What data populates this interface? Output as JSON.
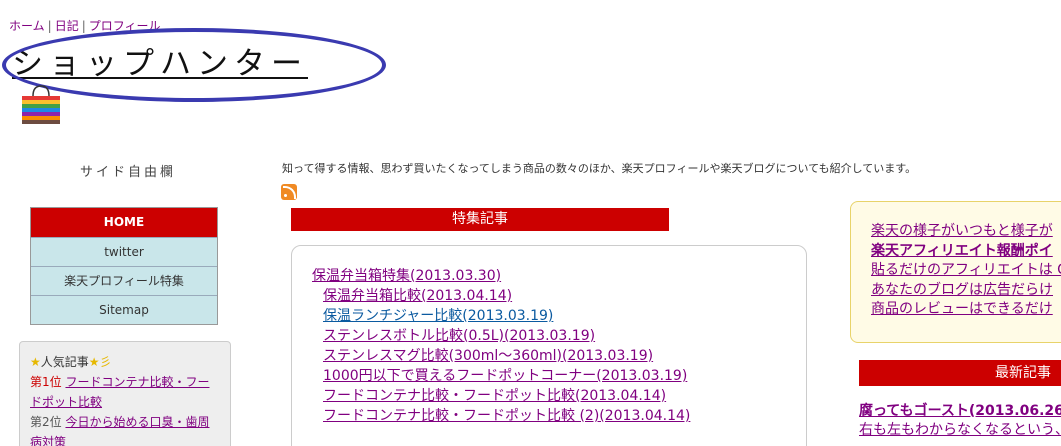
{
  "nav": {
    "home": "ホーム",
    "diary": "日記",
    "profile": "プロフィール",
    "sep": "|"
  },
  "site": {
    "title": "ショップハンター"
  },
  "sidebar": {
    "title": "サイド自由欄",
    "menu": [
      "HOME",
      "twitter",
      "楽天プロフィール特集",
      "Sitemap"
    ],
    "popular": {
      "heading": "人気記事",
      "items": [
        {
          "rank": "第1位",
          "title": "フードコンテナ比較・フードポット比較"
        },
        {
          "rank": "第2位",
          "title": "今日から始める口臭・歯周病対策"
        }
      ]
    }
  },
  "main": {
    "description": "知って得する情報、思わず買いたくなってしまう商品の数々のほか、楽天プロフィールや楽天ブログについても紹介しています。",
    "feature_heading": "特集記事",
    "features": [
      "保温弁当箱特集(2013.03.30)",
      "保温弁当箱比較(2013.04.14)",
      "保温ランチジャー比較(2013.03.19)",
      "ステンレスボトル比較(0.5L)(2013.03.19)",
      "ステンレスマグ比較(300ml〜360ml)(2013.03.19)",
      "1000円以下で買えるフードポットコーナー(2013.03.19)",
      "フードコンテナ比較・フードポット比較(2013.04.14)",
      "フードコンテナ比較・フードポット比較 (2)(2013.04.14)"
    ]
  },
  "right": {
    "links": [
      "楽天の様子がいつもと様子が",
      "楽天アフィリエイト報酬ポイ",
      "貼るだけのアフィリエイトは C",
      "あなたのブログは広告だらけ",
      "商品のレビューはできるだけ"
    ],
    "latest_heading": "最新記事",
    "latest": [
      "腐ってもゴースト(2013.06.26",
      "右も左もわからなくなるという、"
    ]
  },
  "colors": {
    "accent_red": "#cc0000",
    "menu_blue": "#c9e6ea",
    "link": "#800080",
    "ellipse": "#3a3ab0"
  }
}
